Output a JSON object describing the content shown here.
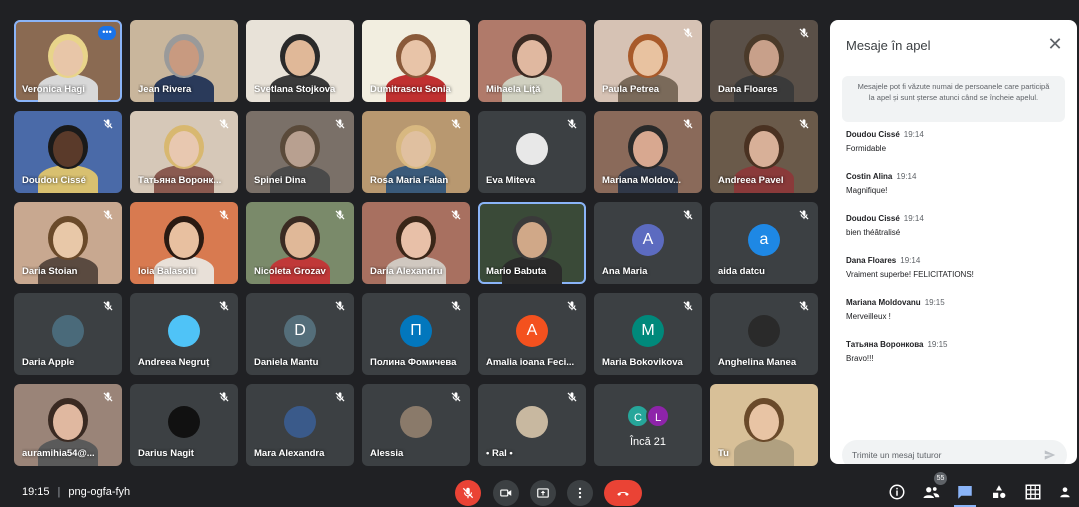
{
  "participants": [
    {
      "name": "Veronica Hagi",
      "muted": false,
      "more": true,
      "speaking": true,
      "type": "video",
      "bg": "#8a6a52",
      "skin": "#e8c6a8",
      "hair": "#e8d48a",
      "shirt": "#d8d8d8"
    },
    {
      "name": "Jean Rivera",
      "muted": false,
      "type": "video",
      "bg": "#c9b69c",
      "skin": "#c89a80",
      "hair": "#9a9a9a",
      "shirt": "#2a3a5a"
    },
    {
      "name": "Svetlana Stojkova",
      "muted": false,
      "type": "video",
      "bg": "#e8e2d8",
      "skin": "#e0b898",
      "hair": "#2a2a2a",
      "shirt": "#3a3a3a"
    },
    {
      "name": "Dumitrascu Sonia",
      "muted": false,
      "type": "video",
      "bg": "#f2eee0",
      "skin": "#e8c4a8",
      "hair": "#8a5a3a",
      "shirt": "#c03030"
    },
    {
      "name": "Mihaela Liţă",
      "muted": false,
      "type": "video",
      "bg": "#b07a6a",
      "skin": "#e0b8a0",
      "hair": "#3a2a22",
      "shirt": "#d0d0c0"
    },
    {
      "name": "Paula Petrea",
      "muted": true,
      "type": "video",
      "bg": "#d6c2b4",
      "skin": "#e8c2a0",
      "hair": "#a85a2a",
      "shirt": "#7a6a5a"
    },
    {
      "name": "Dana Floares",
      "muted": true,
      "type": "video",
      "bg": "#5a5048",
      "skin": "#c8a08a",
      "hair": "#4a3a2a",
      "shirt": "#3a3a3a"
    },
    {
      "name": "Doudou Cissé",
      "muted": true,
      "type": "video",
      "bg": "#4a6aa8",
      "skin": "#5a3a2a",
      "hair": "#1a1a1a",
      "shirt": "#d8c070"
    },
    {
      "name": "Татьяна Воронк...",
      "muted": true,
      "type": "video",
      "bg": "#d6c8b8",
      "skin": "#e8c8b0",
      "hair": "#d8b870",
      "shirt": "#8a5a50"
    },
    {
      "name": "Spinei Dina",
      "muted": true,
      "type": "video",
      "bg": "#7a7068",
      "skin": "#b8a090",
      "hair": "#5a4a3a",
      "shirt": "#4a4a4a"
    },
    {
      "name": "Rosa Maria Falan",
      "muted": true,
      "type": "video",
      "bg": "#b89870",
      "skin": "#e0c0a0",
      "hair": "#d8b880",
      "shirt": "#3a5a7a"
    },
    {
      "name": "Eva Miteva",
      "muted": true,
      "type": "photo",
      "bg": "#3c4043",
      "avatar": "#e8e8e8"
    },
    {
      "name": "Mariana Moldov...",
      "muted": true,
      "type": "video",
      "bg": "#8a6a5a",
      "skin": "#d8a890",
      "hair": "#2a2a2a",
      "shirt": "#303848"
    },
    {
      "name": "Andreea Pavel",
      "muted": true,
      "type": "video",
      "bg": "#6a5a4a",
      "skin": "#d8b098",
      "hair": "#4a3222",
      "shirt": "#8a3a3a"
    },
    {
      "name": "Daria Stoian",
      "muted": true,
      "type": "video",
      "bg": "#c8a890",
      "skin": "#e8c8a8",
      "hair": "#6a4a2a",
      "shirt": "#5a4a40"
    },
    {
      "name": "Ioia Balasoiu",
      "muted": true,
      "type": "video",
      "bg": "#d87a50",
      "skin": "#e8c0a0",
      "hair": "#2a1a12",
      "shirt": "#e8e0d8"
    },
    {
      "name": "Nicoleta Grozav",
      "muted": true,
      "type": "video",
      "bg": "#7a8a6a",
      "skin": "#e0b898",
      "hair": "#3a2a22",
      "shirt": "#c03838"
    },
    {
      "name": "Daria Alexandru",
      "muted": true,
      "type": "video",
      "bg": "#a87060",
      "skin": "#e8c0a8",
      "hair": "#3a2618",
      "shirt": "#d0c8c0"
    },
    {
      "name": "Mario Babuta",
      "muted": false,
      "speaking": true,
      "type": "video",
      "bg": "#3a4a38",
      "skin": "#d0a888",
      "hair": "#3a3a3a",
      "shirt": "#2a2a2a"
    },
    {
      "name": "Ana Maria",
      "muted": true,
      "type": "letter",
      "letter": "A",
      "avatar": "#5c6bc0"
    },
    {
      "name": "aida datcu",
      "muted": true,
      "type": "letter",
      "letter": "a",
      "avatar": "#1e88e5"
    },
    {
      "name": "Daria Apple",
      "muted": true,
      "type": "photo",
      "avatar": "#4a6a7a"
    },
    {
      "name": "Andreea Negruț",
      "muted": true,
      "type": "photo",
      "avatar": "#4fc3f7"
    },
    {
      "name": "Daniela Mantu",
      "muted": true,
      "type": "letter",
      "letter": "D",
      "avatar": "#546e7a"
    },
    {
      "name": "Полина Фомичева",
      "muted": true,
      "type": "letter",
      "letter": "П",
      "avatar": "#0277bd"
    },
    {
      "name": "Amalia ioana Feci...",
      "muted": true,
      "type": "letter",
      "letter": "A",
      "avatar": "#f4511e"
    },
    {
      "name": "Maria Bokovikova",
      "muted": true,
      "type": "letter",
      "letter": "M",
      "avatar": "#00897b"
    },
    {
      "name": "Anghelina Manea",
      "muted": true,
      "type": "photo",
      "avatar": "#2a2a2a"
    },
    {
      "name": "auramihia54@...",
      "muted": true,
      "type": "video",
      "bg": "#9a8478",
      "skin": "#e0b8a0",
      "hair": "#3a2a22",
      "shirt": "#5a5a5a"
    },
    {
      "name": "Darius Nagit",
      "muted": true,
      "type": "photo",
      "avatar": "#111111"
    },
    {
      "name": "Mara Alexandra",
      "muted": true,
      "type": "photo",
      "avatar": "#3a5a8a"
    },
    {
      "name": "Alessia",
      "muted": true,
      "type": "photo",
      "avatar": "#8a7a6a"
    },
    {
      "name": "• Ral •",
      "muted": true,
      "type": "photo",
      "avatar": "#c8b8a0"
    },
    {
      "name": "Încă 21",
      "type": "more",
      "a": "C",
      "a_color": "#26a69a",
      "b": "L",
      "b_color": "#8e24aa"
    },
    {
      "name": "Tu",
      "muted": false,
      "type": "video",
      "bg": "#d8c098",
      "skin": "#e8c4a4",
      "hair": "#6a4a2a",
      "shirt": "#b0a080"
    }
  ],
  "chat": {
    "title": "Mesaje în apel",
    "notice": "Mesajele pot fi văzute numai de persoanele care participă la apel și sunt șterse atunci când se încheie apelul.",
    "messages": [
      {
        "sender": "Doudou Cissé",
        "time": "19:14",
        "text": "Formidable"
      },
      {
        "sender": "Costin Alina",
        "time": "19:14",
        "text": "Magnifique!"
      },
      {
        "sender": "Doudou Cissé",
        "time": "19:14",
        "text": "bien théâtralisé"
      },
      {
        "sender": "Dana Floares",
        "time": "19:14",
        "text": "Vraiment superbe! FELICITATIONS!"
      },
      {
        "sender": "Mariana Moldovanu",
        "time": "19:15",
        "text": "Merveilleux !"
      },
      {
        "sender": "Татьяна Воронкова",
        "time": "19:15",
        "text": "Bravo!!!"
      }
    ],
    "input_placeholder": "Trimite un mesaj tuturor"
  },
  "bottom": {
    "time": "19:15",
    "meeting_code": "png-ogfa-fyh",
    "people_count": "55"
  },
  "icons": {
    "mic_off": "mic-off-icon",
    "camera": "camera-icon",
    "present": "present-icon",
    "more": "more-vert-icon",
    "hangup": "hangup-icon",
    "info": "info-icon",
    "people": "people-icon",
    "chat": "chat-icon",
    "activities": "activities-icon",
    "layout": "grid-layout-icon",
    "host": "host-controls-icon"
  },
  "colors": {
    "background": "#202124",
    "tile": "#3c4043",
    "danger": "#ea4335",
    "accent": "#8ab4f8"
  }
}
